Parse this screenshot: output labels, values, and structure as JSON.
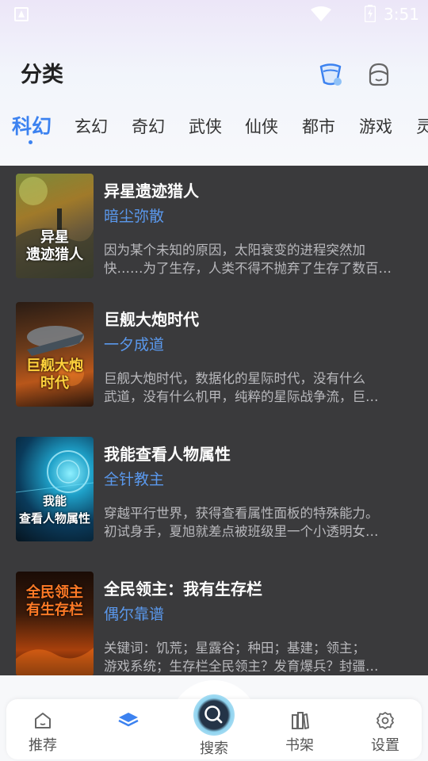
{
  "status": {
    "time": "3:51"
  },
  "header": {
    "title": "分类"
  },
  "tabs": [
    {
      "label": "科幻",
      "active": true
    },
    {
      "label": "玄幻"
    },
    {
      "label": "奇幻"
    },
    {
      "label": "武侠"
    },
    {
      "label": "仙侠"
    },
    {
      "label": "都市"
    },
    {
      "label": "游戏"
    },
    {
      "label": "灵"
    }
  ],
  "books": [
    {
      "title": "异星遗迹猎人",
      "author": "暗尘弥散",
      "desc_line1": " 因为某个未知的原因，太阳衰变的进程突然加",
      "desc_line2": "快……为了生存，人类不得不抛弃了生存了数百…",
      "cover_text": "异星\n遗迹猎人"
    },
    {
      "title": "巨舰大炮时代",
      "author": "一夕成道",
      "desc_line1": " 巨舰大炮时代，数据化的星际时代，没有什么",
      "desc_line2": "武道，没有什么机甲，纯粹的星际战争流，巨…",
      "cover_text": "巨舰大炮\n时代"
    },
    {
      "title": "我能查看人物属性",
      "author": "全针教主",
      "desc_line1": " 穿越平行世界，获得查看属性面板的特殊能力。",
      "desc_line2": "初试身手，夏旭就差点被班级里一个小透明女…",
      "cover_text": "我能\n查看人物属性"
    },
    {
      "title": "全民领主：我有生存栏",
      "author": "偶尔靠谱",
      "desc_line1": " 关键词：饥荒；星露谷；种田；基建；领主；",
      "desc_line2": "游戏系统；生存栏全民领主？发育爆兵？封疆…",
      "cover_text": "全民领主\n有生存栏"
    }
  ],
  "nav": {
    "recommend": "推荐",
    "search": "搜索",
    "bookshelf": "书架",
    "settings": "设置"
  },
  "colors": {
    "accent": "#3c82f0",
    "list_bg": "#3a3a3c",
    "author": "#5a98ec"
  }
}
